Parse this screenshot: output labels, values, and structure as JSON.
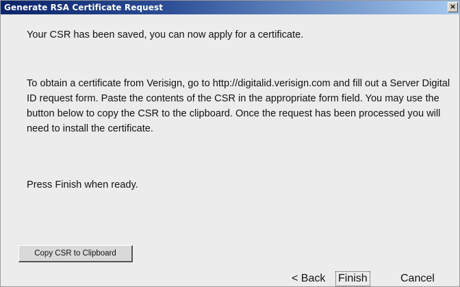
{
  "window": {
    "title": "Generate RSA Certificate Request",
    "close_glyph": "×"
  },
  "content": {
    "paragraph_1": "Your CSR has been saved, you can now apply for a certificate.",
    "paragraph_2": "To obtain a certificate from Verisign, go to http://digitalid.verisign.com and fill out a Server Digital ID request form. Paste the contents of the CSR in the appropriate form field. You may use the button below to copy the CSR to the clipboard.  Once the request has been processed you will need to install the certificate.",
    "paragraph_3": "Press Finish when ready."
  },
  "buttons": {
    "copy_csr": "Copy CSR to Clipboard",
    "back": "< Back",
    "finish": "Finish",
    "cancel": "Cancel"
  },
  "colors": {
    "title_bar_start": "#0a246a",
    "title_bar_end": "#a6caf0",
    "dialog_background": "#ececec"
  },
  "icons": {
    "close": "close-icon"
  }
}
